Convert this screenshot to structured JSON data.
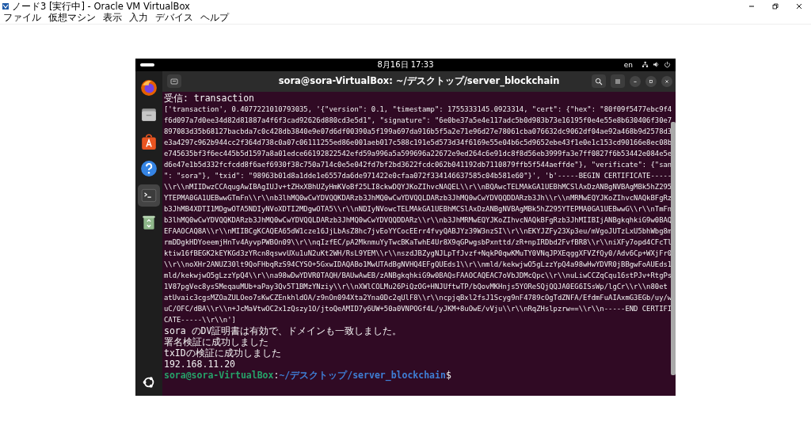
{
  "host_window": {
    "title": "ノード3 [実行中] - Oracle VM VirtualBox",
    "menu": [
      "ファイル",
      "仮想マシン",
      "表示",
      "入力",
      "デバイス",
      "ヘルプ"
    ]
  },
  "guest": {
    "top_bar": {
      "clock": "8月16日 17:33",
      "input_method": "en"
    },
    "dock": [
      {
        "kind": "browser",
        "selected": false
      },
      {
        "kind": "files",
        "selected": false
      },
      {
        "kind": "store",
        "selected": false
      },
      {
        "kind": "help",
        "selected": false
      },
      {
        "kind": "terminal",
        "selected": true
      },
      {
        "kind": "trash",
        "selected": false
      }
    ],
    "terminal": {
      "title": "sora@sora-VirtualBox: ~/デスクトップ/server_blockchain",
      "lines": [
        {
          "kind": "message",
          "text": "受信: transaction"
        },
        {
          "kind": "data",
          "text": "['transaction', 0.4077221010793035, '{\"version\": 0.1, \"timestamp\": 1755333145.0923314, \"cert\": {\"hex\": \"80f09f5477ebc9f4"
        },
        {
          "kind": "data",
          "text": "f6d097a7d0ee34d82d81887a4f6f3cad92626d880cd3e5d1\", \"signature\": \"6e0be37a5e4e117adc5b0d983b73e16195f0e4e55e8b630406f30e7"
        },
        {
          "kind": "data",
          "text": "897083d35b68127bacbda7c0c428db3840e9e07d6df00390a5f199a697da916b5f5a2e71e96d27e78061cba076632dc9062df04ae92a468b9d2578d3"
        },
        {
          "kind": "data",
          "text": "e3a4297c962b944cc2f364d738c0a07c06111255ed86e001aeb017c588c191e5d573d34f6169e55e04b6c5d9652ebe43f1e0e1c153cd90166e8ec08b"
        },
        {
          "kind": "data",
          "text": "e745635bf3f6ec445b5d1597a8a01edce66192822542efd59a996a5a599696a22672e9ed264c6e91dc8f8d56eb3999fa3e7ff0827f6b53442e084e5e"
        },
        {
          "kind": "data",
          "text": "d6e47e1b5d332fcfcdd8f6aef6930f38c750a714c0e5e042fd7bf2bd3622fcdc062b041192db7110879ffb5f544aeffde\"}, \"verificate\": {\"san"
        },
        {
          "kind": "data",
          "text": "\": \"sora\"}, \"txid\": \"98963b01d8a1dde1e6557da6de971422e0cfaa072f334146637585c04b581e60\"}', 'b'-----BEGIN CERTIFICATE-----"
        },
        {
          "kind": "data",
          "text": "\\\\r\\\\nMIIDwzCCAqugAwIBAgIUJv+tZHxXBhUZyHmKVoBf25LI8ckwDQYJKoZIhvcNAQEL\\\\r\\\\nBQAwcTELMAkGA1UEBhMCSlAxDzANBgNVBAgMBk5hZ295"
        },
        {
          "kind": "data",
          "text": "YTEPMA0GA1UEBwwGTmFn\\\\r\\\\nb3lhMQ0wCwYDVQQKDARzb3JhMQ0wCwYDVQQLDARzb3JhMQ0wCwYDVQQDDARzb3Jh\\\\r\\\\nMRMwEQYJKoZIhvcNAQkBFgRz"
        },
        {
          "kind": "data",
          "text": "b3JhMB4XDTI1MDgwOTA5NDIyNVoXDTI2MDgwOTA5\\\\r\\\\nNDIyNVowcTELMAkGA1UEBhMCSlAxDzANBgNVBAgMBk5hZ295YTEPMA0GA1UEBwwG\\\\r\\\\nTmFn"
        },
        {
          "kind": "data",
          "text": "b3lhMQ0wCwYDVQQKDARzb3JhMQ0wCwYDVQQLDARzb3JhMQ0wCwYDVQQDDARz\\\\r\\\\nb3JhMRMwEQYJKoZIhvcNAQkBFgRzb3JhMIIBIjANBgkqhkiG9w0BAQ"
        },
        {
          "kind": "data",
          "text": "EFAAOCAQ8A\\\\r\\\\nMIIBCgKCAQEA65dW1cze16JjLbAsZ8hc7jvEoYYCocEErr4fvyQABJYz39W3nzSI\\\\r\\\\nEKYJZFy23Xp3eu/mVgoJUTzLxU5bhWbg8m"
        },
        {
          "kind": "data",
          "text": "rmDDgkHDYoeemjHnTv4AyvpPWBOn09\\\\r\\\\nqIzfEC/pA2MknmuYyTwcBKaTwhE4Ur8X9qGPwgsbPxnttd/zR+npIRDbd2FvfBR8\\\\r\\\\niXFy7opd4CFcTl"
        },
        {
          "kind": "data",
          "text": "ktiw16fBEGK2kEYKGd3zYRcn8qswvUXu1uN2uKt2WH/RsL9YEM\\\\r\\\\nszdJBZygNJLpTfJvzf+NqkP0qwKMuTY0VNqJPXEqggXFVZfQy0/Adv6Cp+WXjFr0"
        },
        {
          "kind": "data",
          "text": "\\\\r\\\\noXHr2ANUZ30lt9QoFHbqRzS94CYSO+5GxwIDAQABo1MwUTAdBgNVHQ4EFgQUEds1\\\\r\\\\nmld/kekwjwO5gLzzYpQ4a98wHwYDVR0jBBgwFoAUEds1"
        },
        {
          "kind": "data",
          "text": "mld/kekwjwO5gLzzYpQ4\\\\r\\\\na98wDwYDVR0TAQH/BAUwAwEB/zANBgkqhkiG9w0BAQsFAAOCAQEAC7oVbJDMcQpc\\\\r\\\\nuLiwCCZqCqu16stPJv+RtgPs"
        },
        {
          "kind": "data",
          "text": "1V87pgVec8ysSMeqauMUb+aPay3Qv5T1BMzYNziy\\\\r\\\\nXWlCOLMu26PiQzOG+HNJUftwTP/bQovMKHnjs5YOReSQjQQJA0EG6ISsWp/lgCr\\\\r\\\\n80et"
        },
        {
          "kind": "data",
          "text": "atUvaic3cgsMZOaZULOeo7sKwCZEnkhldOA/z9nOn094Xta2Yna0Dc2qUlF8\\\\r\\\\ncpjqBxl2fsJ1Scyg9nF4789cOgTdZNFA/EfdmFuAIAxmG3EGb/uy/w"
        },
        {
          "kind": "data",
          "text": "uC/OFC/dBA\\\\r\\\\n+JcMaVtwOC2x1zQszy1O/jtoQeAMID7y6UW+50a0VNPOGf4L/yJKM+8uOwE/vVju\\\\r\\\\nRqZHslpzrw==\\\\r\\\\n-----END CERTIFI"
        },
        {
          "kind": "data",
          "text": "CATE-----\\\\r\\\\n']"
        },
        {
          "kind": "message",
          "text": "sora のDV証明書は有効で、ドメインも一致しました。"
        },
        {
          "kind": "message",
          "text": "署名検証に成功しました"
        },
        {
          "kind": "message",
          "text": "txIDの検証に成功しました"
        },
        {
          "kind": "message",
          "text": "192.168.11.20"
        }
      ],
      "prompt": {
        "user": "sora@sora-VirtualBox",
        "separator": ":",
        "path": "~/デスクトップ/server_blockchain",
        "symbol": "$"
      }
    }
  }
}
